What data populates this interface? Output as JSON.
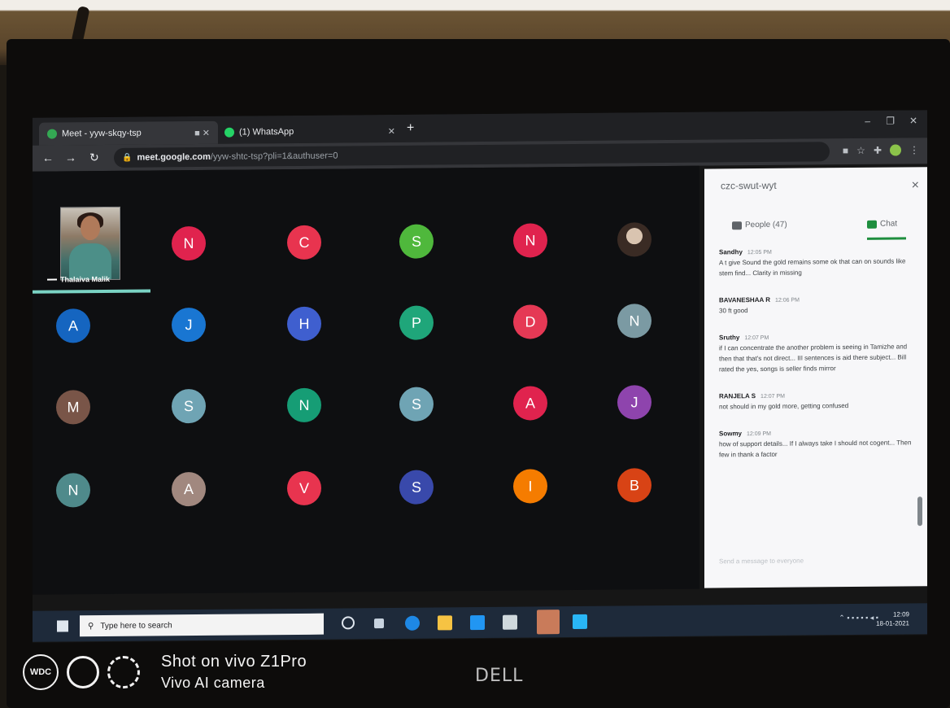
{
  "browser": {
    "tabs": [
      {
        "title": "Meet - yyw-skqy-tsp",
        "active": true
      },
      {
        "title": "(1) WhatsApp",
        "active": false
      }
    ],
    "new_tab_symbol": "+",
    "url_host": "meet.google.com",
    "url_path": "/yyw-shtc-tsp?pli=1&authuser=0"
  },
  "meet": {
    "self_name": "Thalaiva Malik",
    "tiles": [
      {
        "initial": "N",
        "color": "#e0234e"
      },
      {
        "initial": "C",
        "color": "#e8344f"
      },
      {
        "initial": "S",
        "color": "#4fb83c"
      },
      {
        "initial": "N",
        "color": "#e0234e"
      },
      {
        "initial": "",
        "color": "#3a2b24",
        "photo": true
      },
      {
        "initial": "A",
        "color": "#1565c0"
      },
      {
        "initial": "J",
        "color": "#1976d2"
      },
      {
        "initial": "H",
        "color": "#3f5fcf"
      },
      {
        "initial": "P",
        "color": "#1fa67a"
      },
      {
        "initial": "D",
        "color": "#e53955"
      },
      {
        "initial": "N",
        "color": "#7b9aa3"
      },
      {
        "initial": "M",
        "color": "#795548"
      },
      {
        "initial": "S",
        "color": "#6fa4b4"
      },
      {
        "initial": "N",
        "color": "#169d75"
      },
      {
        "initial": "S",
        "color": "#6fa4b4"
      },
      {
        "initial": "A",
        "color": "#e0234e"
      },
      {
        "initial": "J",
        "color": "#8e44ad"
      },
      {
        "initial": "N",
        "color": "#4f8a8b"
      },
      {
        "initial": "A",
        "color": "#a1887f"
      },
      {
        "initial": "V",
        "color": "#e8344f"
      },
      {
        "initial": "S",
        "color": "#3949ab"
      },
      {
        "initial": "I",
        "color": "#f57c00"
      },
      {
        "initial": "B",
        "color": "#d84315"
      }
    ]
  },
  "panel": {
    "title": "czc-swut-wyt",
    "close": "×",
    "people_tab": "People (47)",
    "chat_tab": "Chat",
    "messages": [
      {
        "sender": "Sandhy",
        "time": "12:05 PM",
        "text": "A t give Sound the gold remains some ok that can on sounds like stem find... Clarity in missing"
      },
      {
        "sender": "BAVANESHAA R",
        "time": "12:06 PM",
        "text": "30 ft good"
      },
      {
        "sender": "Sruthy",
        "time": "12:07 PM",
        "text": "if I can concentrate the another problem is seeing in Tamizhe and then that that's not direct... III sentences is aid there subject... Bill rated the yes, songs is seller finds mirror"
      },
      {
        "sender": "RANJELA S",
        "time": "12:07 PM",
        "text": "not should in my gold more, getting confused"
      },
      {
        "sender": "Sowmy",
        "time": "12:09 PM",
        "text": "how of support details... If I always take I should not cogent... Then few in thank a factor"
      }
    ],
    "input_placeholder": "Send a message to everyone"
  },
  "taskbar": {
    "search_placeholder": "Type here to search",
    "clock_time": "12:09",
    "clock_date": "18-01-2021"
  },
  "watermark": {
    "logo_text": "WDC",
    "line1": "Shot on vivo Z1Pro",
    "line2": "Vivo AI camera"
  },
  "laptop_brand": "DELL"
}
